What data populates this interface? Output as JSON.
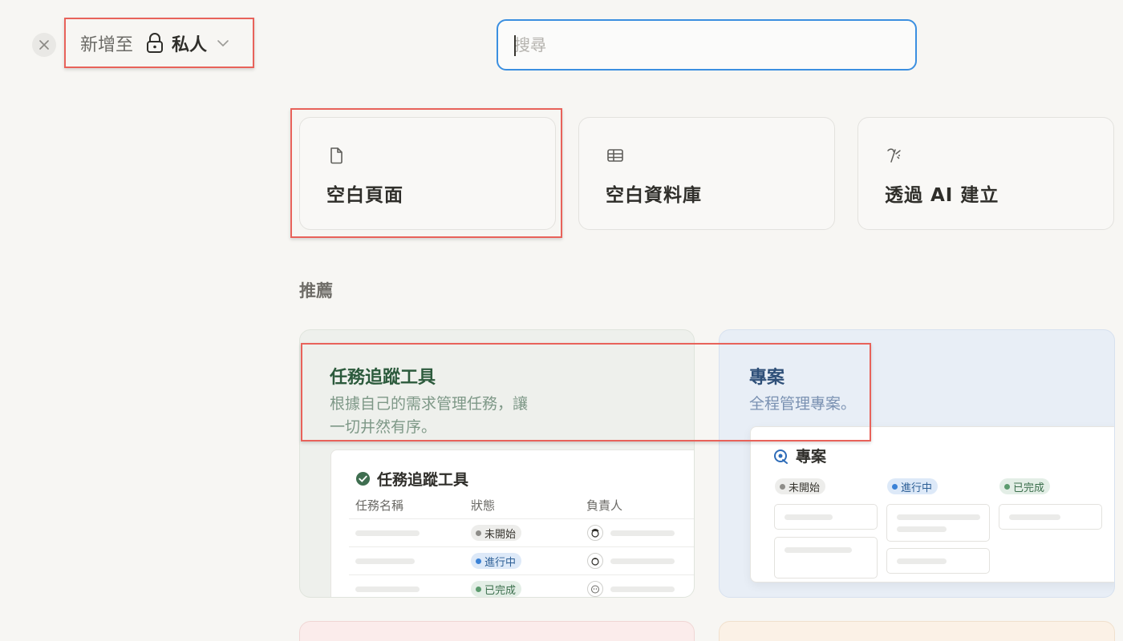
{
  "header": {
    "close_icon": "close-icon",
    "add_to_label": "新增至",
    "location_icon": "lock-icon",
    "location": "私人",
    "dropdown_icon": "chevron-down-icon"
  },
  "search": {
    "placeholder": "搜尋",
    "value": ""
  },
  "create_options": [
    {
      "icon": "page-icon",
      "label": "空白頁面"
    },
    {
      "icon": "table-icon",
      "label": "空白資料庫"
    },
    {
      "icon": "ai-sparkle-icon",
      "label": "透過 AI 建立"
    }
  ],
  "recommended": {
    "title": "推薦",
    "templates": [
      {
        "name": "任務追蹤工具",
        "description": "根據自己的需求管理任務，讓一切井然有序。",
        "preview": {
          "title": "任務追蹤工具",
          "columns": [
            "任務名稱",
            "狀態",
            "負責人"
          ],
          "rows": [
            {
              "status": "未開始",
              "status_color": "gray"
            },
            {
              "status": "進行中",
              "status_color": "blue"
            },
            {
              "status": "已完成",
              "status_color": "green"
            }
          ]
        }
      },
      {
        "name": "專案",
        "description": "全程管理專案。",
        "preview": {
          "title": "專案",
          "groups": [
            "未開始",
            "進行中",
            "已完成"
          ]
        }
      }
    ]
  },
  "colors": {
    "highlight": "#e8625a",
    "search_border": "#3b8fe0",
    "task_accent": "#2c5a3c",
    "project_accent": "#2e4f78"
  }
}
